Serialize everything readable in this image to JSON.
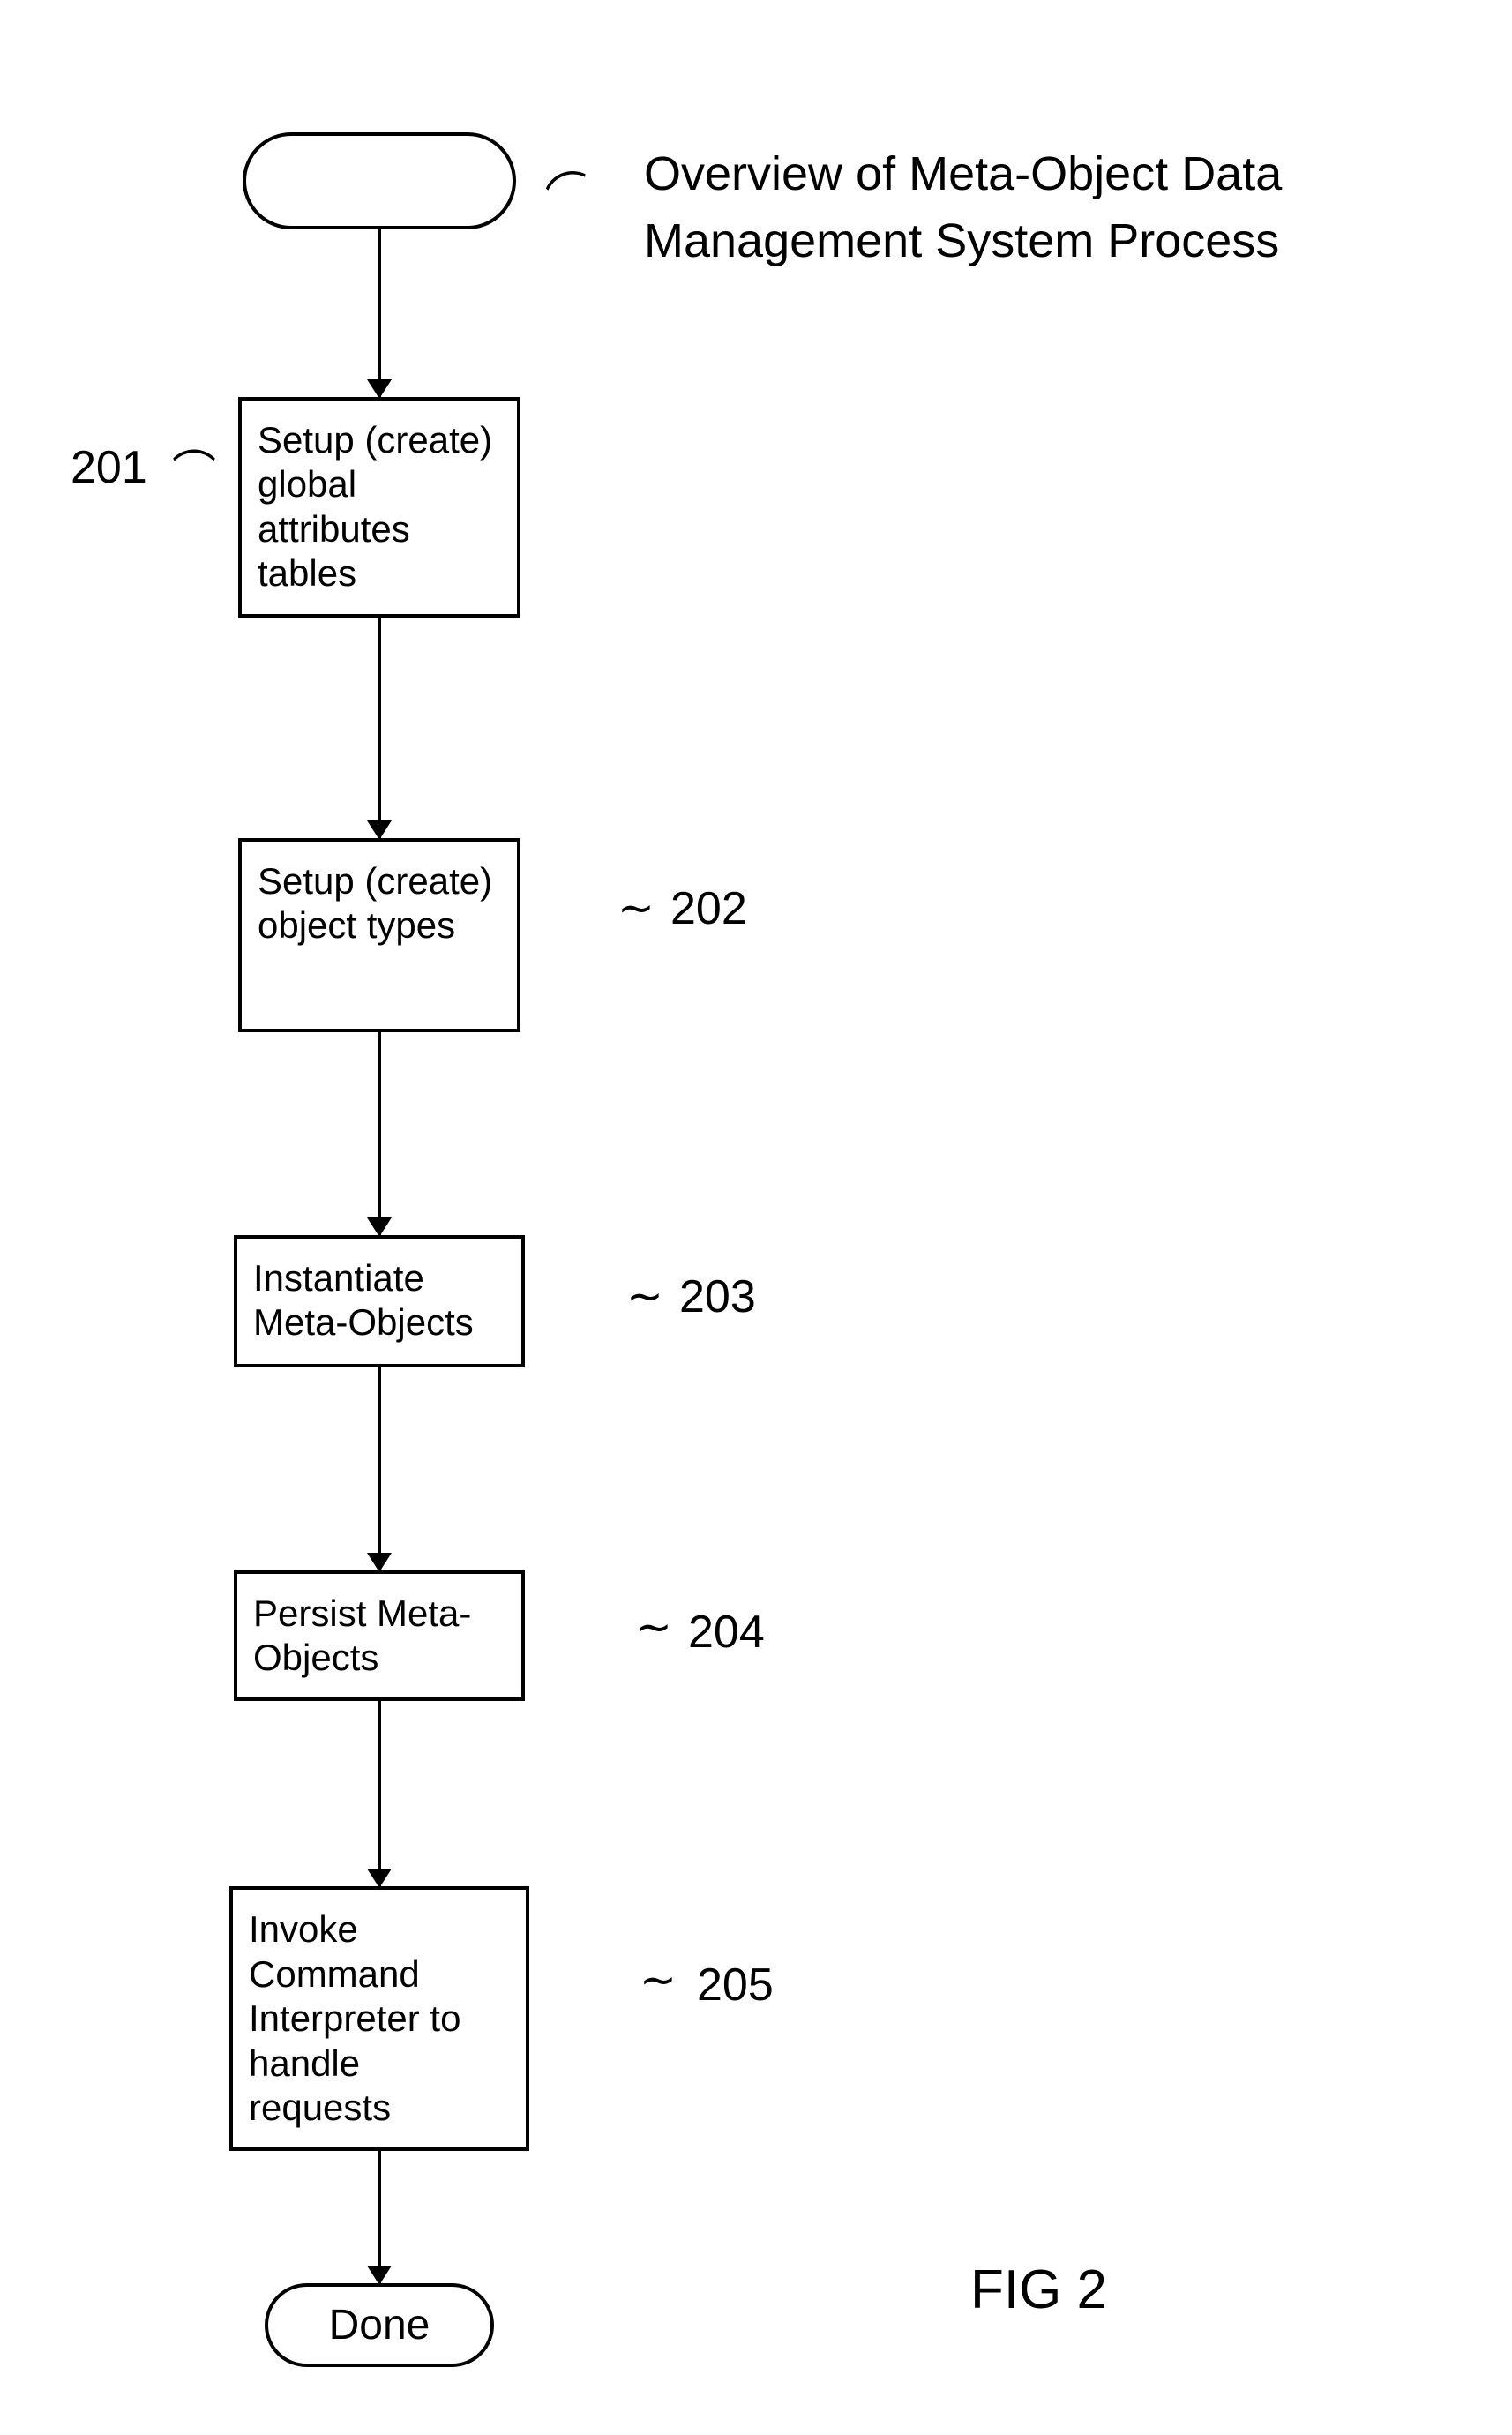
{
  "diagram": {
    "title": "Overview of Meta-Object Data Management System Process",
    "figure_label": "FIG 2",
    "start": "",
    "end": "Done",
    "steps": [
      {
        "ref": "201",
        "text": "Setup (create) global attributes tables"
      },
      {
        "ref": "202",
        "text": "Setup (create) object types"
      },
      {
        "ref": "203",
        "text": "Instantiate Meta-Objects"
      },
      {
        "ref": "204",
        "text": "Persist Meta-Objects"
      },
      {
        "ref": "205",
        "text": "Invoke Command Interpreter to handle requests"
      }
    ]
  }
}
